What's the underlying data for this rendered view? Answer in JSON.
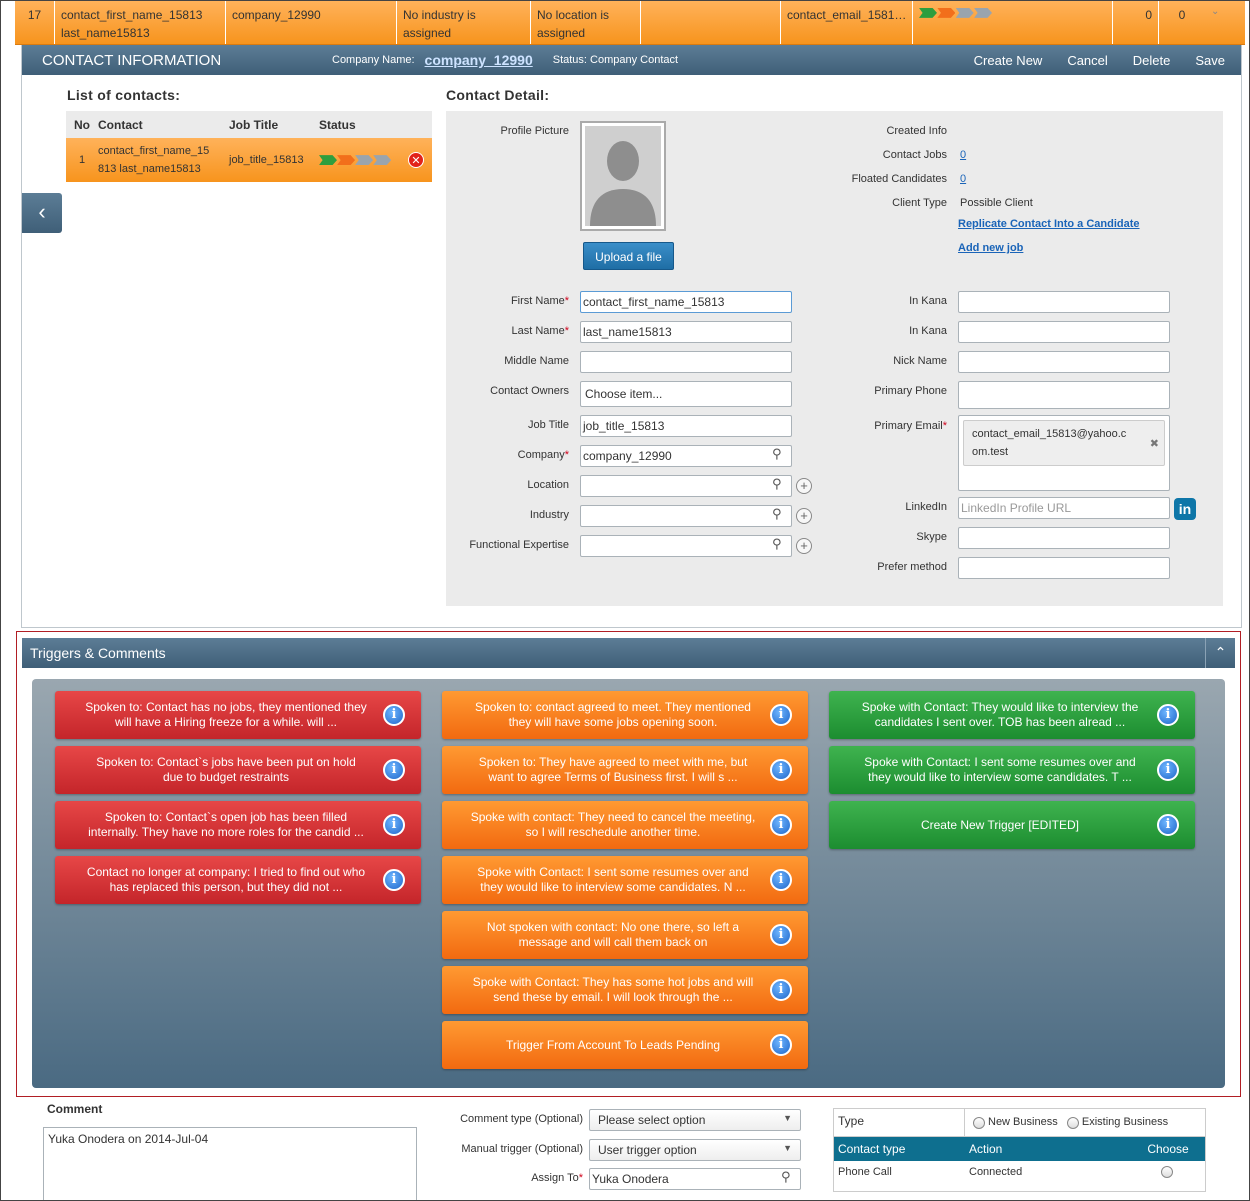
{
  "top_row": {
    "no": "17",
    "contact": "contact_first_name_15813",
    "contact2": "last_name15813",
    "company": "company_12990",
    "industry1": "No industry is",
    "industry2": "assigned",
    "location1": "No location is",
    "location2": "assigned",
    "email": "contact_email_1581…",
    "count1": "0",
    "count2": "0"
  },
  "header": {
    "title": "CONTACT INFORMATION",
    "company_label": "Company Name:",
    "company_name": "company_12990",
    "status": "Status: Company Contact",
    "actions": [
      "Create New",
      "Cancel",
      "Delete",
      "Save"
    ]
  },
  "contacts_list": {
    "title": "List of contacts:",
    "columns": [
      "No",
      "Contact",
      "Job Title",
      "Status"
    ],
    "rows": [
      {
        "no": "1",
        "contact1": "contact_first_name_15",
        "contact2": "813 last_name15813",
        "job_title": "job_title_15813"
      }
    ]
  },
  "detail": {
    "title": "Contact Detail:",
    "profile_picture_label": "Profile Picture",
    "upload_label": "Upload a file",
    "created_info_label": "Created Info",
    "contact_jobs_label": "Contact Jobs",
    "contact_jobs_value": "0",
    "floated_label": "Floated Candidates",
    "floated_value": "0",
    "client_type_label": "Client Type",
    "client_type_value": "Possible Client",
    "replicate_link": "Replicate Contact Into a Candidate",
    "add_job_link": "Add new job",
    "first_name_label": "First Name",
    "first_name_value": "contact_first_name_15813",
    "last_name_label": "Last Name",
    "last_name_value": "last_name15813",
    "middle_name_label": "Middle Name",
    "owners_label": "Contact Owners",
    "owners_placeholder": "Choose item...",
    "job_title_label": "Job Title",
    "job_title_value": "job_title_15813",
    "company_label": "Company",
    "company_value": "company_12990",
    "location_label": "Location",
    "industry_label": "Industry",
    "expertise_label": "Functional Expertise",
    "in_kana_label": "In Kana",
    "in_kana2_label": "In Kana",
    "nick_name_label": "Nick Name",
    "primary_phone_label": "Primary Phone",
    "primary_email_label": "Primary Email",
    "primary_email_value1": "contact_email_15813@yahoo.c",
    "primary_email_value2": "om.test",
    "linkedin_label": "LinkedIn",
    "linkedin_placeholder": "LinkedIn Profile URL",
    "skype_label": "Skype",
    "prefer_label": "Prefer method"
  },
  "triggers": {
    "title": "Triggers & Comments",
    "red": [
      {
        "line1": "Spoken to: Contact has no jobs, they mentioned they",
        "line2": "will have a Hiring freeze for a while. will ..."
      },
      {
        "line1": "Spoken to: Contact`s jobs have been put on hold",
        "line2": "due to budget restraints"
      },
      {
        "line1": "Spoken to: Contact`s open job has been filled",
        "line2": "internally. They have no more roles for the candid ..."
      },
      {
        "line1": "Contact no longer at company: I tried to find out who",
        "line2": "has replaced this person, but they did not ..."
      }
    ],
    "orange": [
      {
        "line1": "Spoken to: contact agreed to meet. They mentioned",
        "line2": "they will have some jobs opening soon."
      },
      {
        "line1": "Spoken to: They have agreed to meet with me, but",
        "line2": "want to agree Terms of Business first. I will s ..."
      },
      {
        "line1": "Spoke with contact: They need to cancel the meeting,",
        "line2": "so I will reschedule another time."
      },
      {
        "line1": "Spoke with Contact: I sent some resumes over and",
        "line2": "they would like to interview some candidates. N ..."
      },
      {
        "line1": "Not spoken with contact: No one there, so left a",
        "line2": "message and will call them back on"
      },
      {
        "line1": "Spoke with Contact: They has some hot jobs and will",
        "line2": "send these by email. I will look through the ..."
      },
      {
        "line1": "Trigger From Account To Leads Pending",
        "line2": ""
      }
    ],
    "green": [
      {
        "line1": "Spoke with Contact: They would like to interview the",
        "line2": "candidates I sent over. TOB has been alread ..."
      },
      {
        "line1": "Spoke with Contact: I sent some resumes over and",
        "line2": "they would like to interview some candidates. T ..."
      },
      {
        "line1": "Create New Trigger [EDITED]",
        "line2": ""
      }
    ]
  },
  "comment": {
    "title": "Comment",
    "text": "Yuka Onodera on 2014-Jul-04",
    "comment_type_label": "Comment type (Optional)",
    "comment_type_value": "Please select option",
    "manual_trigger_label": "Manual trigger (Optional)",
    "manual_trigger_value": "User trigger option",
    "assign_label": "Assign To",
    "assign_value": "Yuka Onodera"
  },
  "type_table": {
    "type_label": "Type",
    "opt1": "New Business",
    "opt2": "Existing Business",
    "columns": [
      "Contact type",
      "Action",
      "Choose"
    ],
    "row1": {
      "contact_type": "Phone Call",
      "action": "Connected"
    }
  },
  "colors": {
    "orange": "#f7941d",
    "header_blue": "#4a6a82",
    "red": "#c4252a",
    "green": "#1c8d30"
  }
}
